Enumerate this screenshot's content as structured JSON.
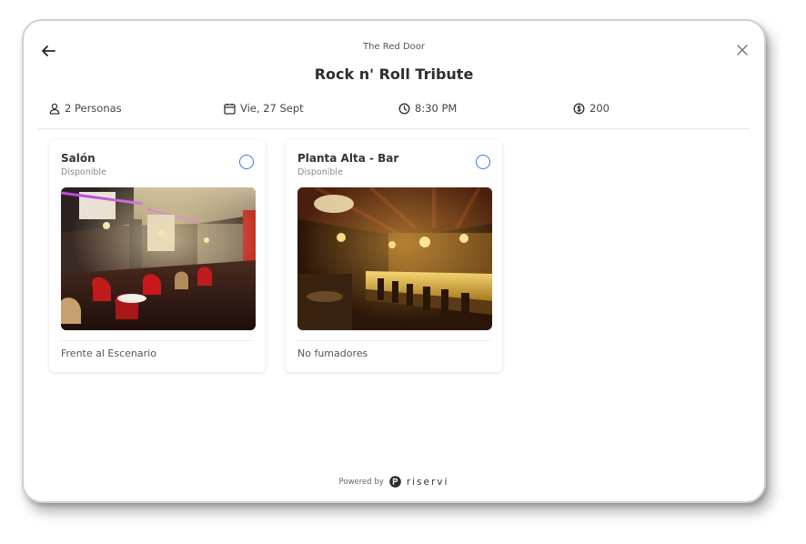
{
  "header": {
    "venue": "The Red Door",
    "title": "Rock n' Roll Tribute",
    "back_icon": "arrow-left-icon",
    "close_icon": "close-icon"
  },
  "info": {
    "guests": "2 Personas",
    "date": "Vie, 27 Sept",
    "time": "8:30 PM",
    "price": "200"
  },
  "areas": [
    {
      "name": "Salón",
      "status": "Disponible",
      "feature": "Frente al Escenario",
      "selected": false
    },
    {
      "name": "Planta Alta - Bar",
      "status": "Disponible",
      "feature": "No fumadores",
      "selected": false
    }
  ],
  "footer": {
    "powered_by": "Powered by",
    "brand": "riservi"
  },
  "colors": {
    "accent": "#3b7ddd",
    "text": "#333333"
  }
}
